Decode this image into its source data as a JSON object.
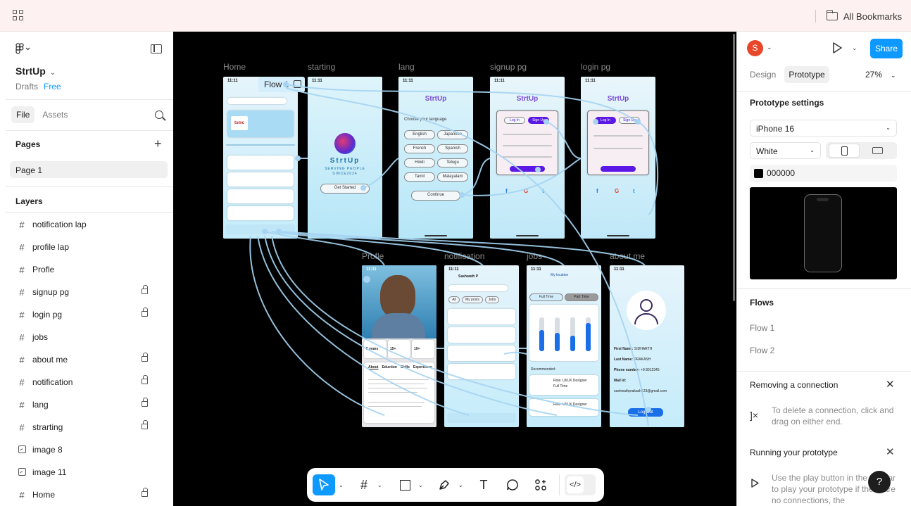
{
  "browser": {
    "bookmarks_label": "All Bookmarks"
  },
  "left_panel": {
    "project_title": "StrtUp",
    "drafts_label": "Drafts",
    "plan_label": "Free",
    "tabs": [
      "File",
      "Assets"
    ],
    "pages_title": "Pages",
    "pages": [
      "Page 1"
    ],
    "layers_title": "Layers",
    "layers": [
      {
        "name": "notification lap",
        "icon": "frame-icon",
        "locked": false
      },
      {
        "name": "profile lap",
        "icon": "frame-icon",
        "locked": false
      },
      {
        "name": "Profle",
        "icon": "frame-icon",
        "locked": false
      },
      {
        "name": "signup pg",
        "icon": "frame-icon",
        "locked": true
      },
      {
        "name": "login pg",
        "icon": "frame-icon",
        "locked": true
      },
      {
        "name": "jobs",
        "icon": "frame-icon",
        "locked": false
      },
      {
        "name": "about me",
        "icon": "frame-icon",
        "locked": true
      },
      {
        "name": "notification",
        "icon": "frame-icon",
        "locked": true
      },
      {
        "name": "lang",
        "icon": "frame-icon",
        "locked": true
      },
      {
        "name": "strarting",
        "icon": "frame-icon",
        "locked": true
      },
      {
        "name": "image 8",
        "icon": "image-icon",
        "locked": false
      },
      {
        "name": "image 11",
        "icon": "image-icon",
        "locked": false
      },
      {
        "name": "Home",
        "icon": "frame-icon",
        "locked": true
      }
    ]
  },
  "canvas": {
    "flow_tag": "Flow 1",
    "frame_labels": {
      "home": "Home",
      "starting": "starting",
      "lang": "lang",
      "signup": "signup pg",
      "login": "login pg",
      "profile": "Profle",
      "notification": "notification",
      "jobs": "jobs",
      "about": "about me"
    },
    "status_time": "11:11",
    "brand": "StrtUp",
    "starting_brand": "StrtUp",
    "starting_tagline": "SERVING PEOPLE",
    "starting_since": "SINCE2024",
    "get_started": "Get Started",
    "lang_prompt": "Choose your language",
    "languages": [
      "English",
      "Japanese",
      "French",
      "Spanish",
      "Hindi",
      "Telugu",
      "Tamil",
      "Malayalam"
    ],
    "continue_label": "Continue",
    "login_label": "Log In",
    "signup_label": "Sign Up",
    "jobs_tabs": [
      "Full Time",
      "Part Time"
    ],
    "jobs_location": "My location",
    "recommended_label": "Recommended:",
    "job_roles": [
      "Role: UI/UX Designer",
      "Role: UI/UX Designer"
    ],
    "job_type": "Full Time",
    "about_fields": [
      {
        "label": "First Name:",
        "value": "SIDHARTH"
      },
      {
        "label": "Last Name:",
        "value": "PRAKASH"
      },
      {
        "label": "Phone number:",
        "value": "+9 8012345"
      },
      {
        "label": "Mail id:",
        "value": "sashwathprakash123@gmail.com"
      }
    ],
    "logout_label": "Log Out",
    "profile_tabs": [
      "About",
      "Eduction",
      "Skills",
      "Experience"
    ],
    "profile_stats": [
      "5 years",
      "15+",
      "10+"
    ],
    "notif_user": "Sashwath P",
    "notif_tabs": [
      "All",
      "My posts",
      "Jobs"
    ]
  },
  "toolbar": {
    "tools": [
      "move-tool",
      "frame-tool",
      "shape-tool",
      "pen-tool",
      "text-tool",
      "comment-tool",
      "actions-tool",
      "dev-mode-toggle"
    ]
  },
  "right_panel": {
    "avatar_initial": "S",
    "share_label": "Share",
    "tabs": [
      "Design",
      "Prototype"
    ],
    "zoom": "27%",
    "prototype_settings_title": "Prototype settings",
    "device": "iPhone 16",
    "device_color": "White",
    "background_hex": "000000",
    "flows_title": "Flows",
    "flows": [
      "Flow 1",
      "Flow 2"
    ],
    "removing_title": "Removing a connection",
    "removing_text": "To delete a connection, click and drag on either end.",
    "running_title": "Running your prototype",
    "running_text": "Use the play button in the toolbar to play your prototype if there are no connections, the",
    "help_label": "?"
  }
}
